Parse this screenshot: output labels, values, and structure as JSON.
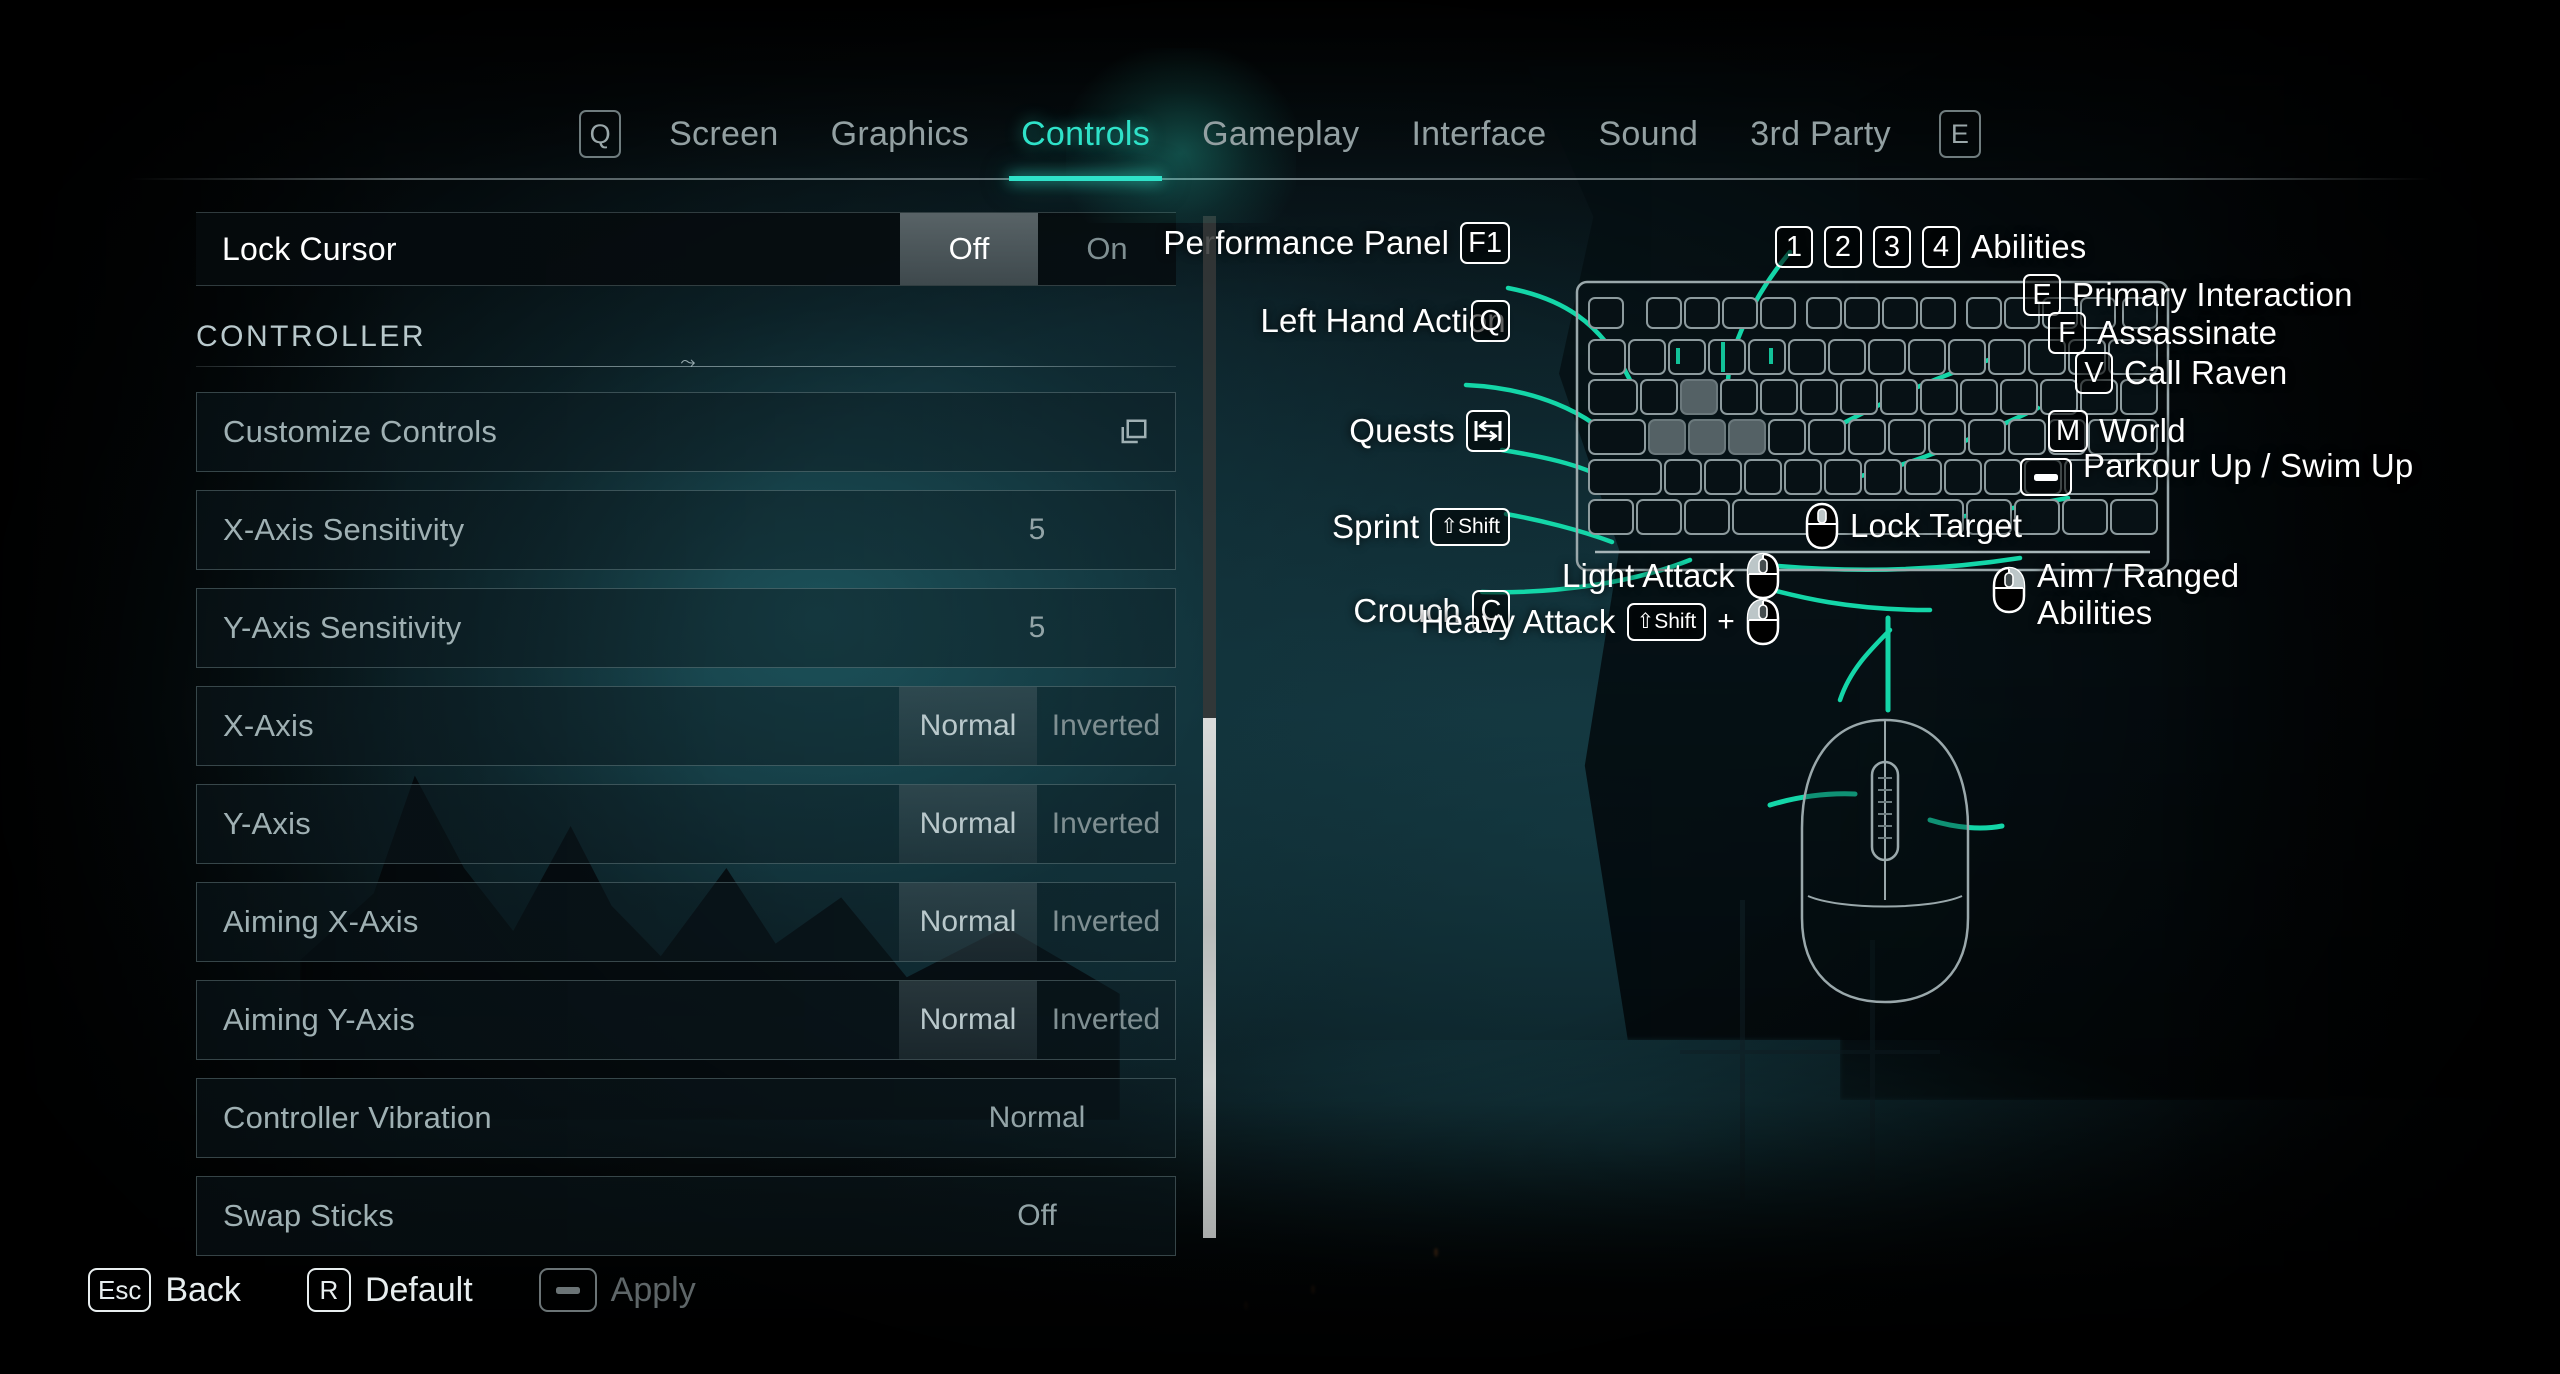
{
  "nav": {
    "left_key": "Q",
    "right_key": "E",
    "tabs": [
      {
        "label": "Screen",
        "active": false
      },
      {
        "label": "Graphics",
        "active": false
      },
      {
        "label": "Controls",
        "active": true
      },
      {
        "label": "Gameplay",
        "active": false
      },
      {
        "label": "Interface",
        "active": false
      },
      {
        "label": "Sound",
        "active": false
      },
      {
        "label": "3rd Party",
        "active": false
      }
    ],
    "accent_color": "#2fe2c9"
  },
  "settings": {
    "top_row": {
      "label": "Lock Cursor",
      "options": [
        "Off",
        "On"
      ],
      "selected": "Off"
    },
    "section_title": "CONTROLLER",
    "rows": [
      {
        "label": "Customize Controls",
        "type": "link",
        "icon": "window-copy-icon"
      },
      {
        "label": "X-Axis Sensitivity",
        "type": "value",
        "value": "5"
      },
      {
        "label": "Y-Axis Sensitivity",
        "type": "value",
        "value": "5"
      },
      {
        "label": "X-Axis",
        "type": "toggle",
        "options": [
          "Normal",
          "Inverted"
        ],
        "selected": "Normal"
      },
      {
        "label": "Y-Axis",
        "type": "toggle",
        "options": [
          "Normal",
          "Inverted"
        ],
        "selected": "Normal"
      },
      {
        "label": "Aiming X-Axis",
        "type": "toggle",
        "options": [
          "Normal",
          "Inverted"
        ],
        "selected": "Normal"
      },
      {
        "label": "Aiming Y-Axis",
        "type": "toggle",
        "options": [
          "Normal",
          "Inverted"
        ],
        "selected": "Normal"
      },
      {
        "label": "Controller Vibration",
        "type": "value",
        "value": "Normal"
      },
      {
        "label": "Swap Sticks",
        "type": "value",
        "value": "Off"
      }
    ]
  },
  "scrollbar": {
    "position_percent": 49
  },
  "diagram": {
    "keyboard_bindings_left": [
      {
        "action": "Performance Panel",
        "key": "F1",
        "key_type": "text"
      },
      {
        "action": "Left Hand Action",
        "key": "Q",
        "key_type": "text"
      },
      {
        "action": "Quests",
        "key": "Tab",
        "key_type": "tab-icon"
      },
      {
        "action": "Sprint",
        "key": "Shift",
        "key_type": "shift-icon"
      },
      {
        "action": "Crouch",
        "key": "C",
        "key_type": "text"
      }
    ],
    "keyboard_bindings_right": [
      {
        "action": "Abilities",
        "keys": [
          "1",
          "2",
          "3",
          "4"
        ],
        "key_type": "text"
      },
      {
        "action": "Primary Interaction",
        "keys": [
          "E"
        ],
        "key_type": "text"
      },
      {
        "action": "Assassinate",
        "keys": [
          "F"
        ],
        "key_type": "text"
      },
      {
        "action": "Call Raven",
        "keys": [
          "V"
        ],
        "key_type": "text"
      },
      {
        "action": "World",
        "keys": [
          "M"
        ],
        "key_type": "text"
      },
      {
        "action": "Parkour Up / Swim Up",
        "keys": [
          "Space"
        ],
        "key_type": "space-icon"
      }
    ],
    "mouse_bindings": [
      {
        "action": "Lock Target",
        "button": "middle",
        "modifier": ""
      },
      {
        "action": "Light Attack",
        "button": "left",
        "modifier": ""
      },
      {
        "action": "Heavy Attack",
        "button": "left",
        "modifier": "Shift",
        "plus": "+"
      },
      {
        "action": "Aim / Ranged Abilities",
        "button": "right",
        "modifier": ""
      }
    ]
  },
  "footer": {
    "items": [
      {
        "key": "Esc",
        "label": "Back",
        "enabled": true
      },
      {
        "key": "R",
        "label": "Default",
        "enabled": true
      },
      {
        "key": "",
        "label": "Apply",
        "enabled": false,
        "key_type": "space-icon"
      }
    ]
  }
}
